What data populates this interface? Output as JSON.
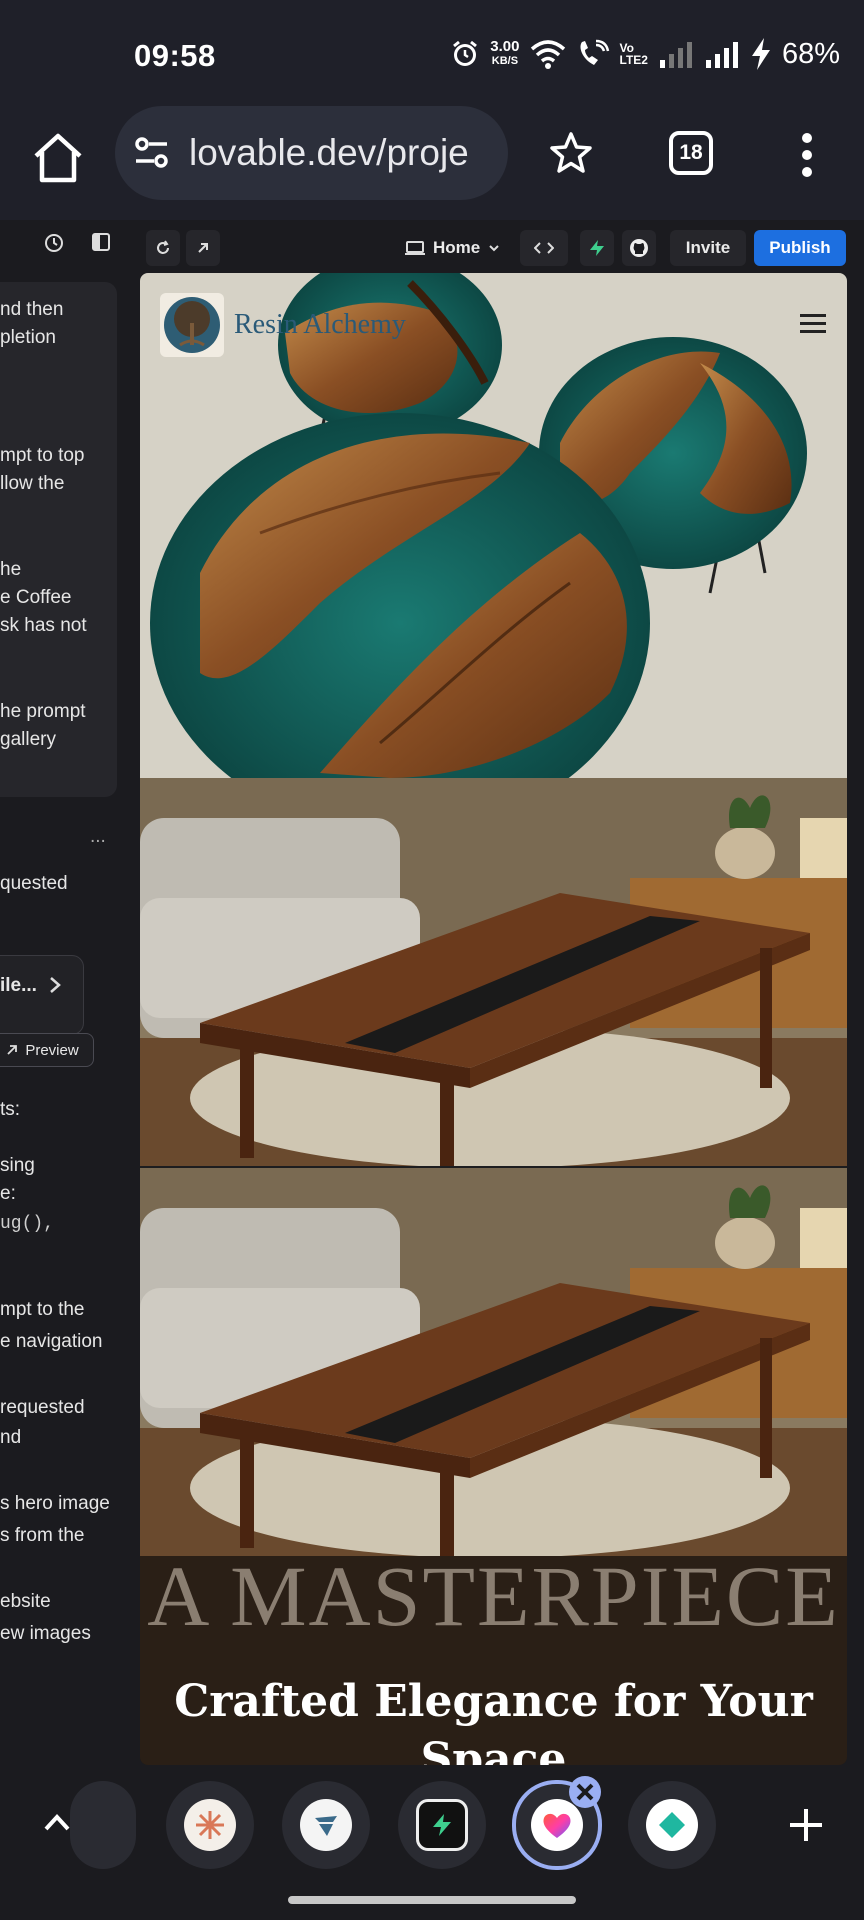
{
  "status_bar": {
    "time": "09:58",
    "speed_value": "3.00",
    "speed_unit": "KB/S",
    "network_label_1": "Vo",
    "network_label_2": "LTE2",
    "battery": "68%"
  },
  "browser": {
    "url": "lovable.dev/proje",
    "tab_count": "18"
  },
  "editor_toolbar": {
    "page_selector": "Home",
    "invite_label": "Invite",
    "publish_label": "Publish"
  },
  "chat_panel": {
    "lines": [
      "nd then",
      "pletion",
      "mpt to top",
      "llow the",
      "he",
      "e Coffee",
      "sk has not",
      "he prompt",
      "gallery",
      "quested",
      "ile...",
      "ts:",
      "sing",
      "e:",
      "ug(),",
      "mpt to the",
      "e navigation",
      "requested",
      "nd",
      "s hero image",
      "s from the",
      "ebsite",
      "ew images"
    ],
    "more_label": "...",
    "preview_label": "Preview"
  },
  "preview_site": {
    "brand_name": "Resin Alchemy",
    "masterpiece_text": "A MASTERPIECE",
    "headline_line1": "Crafted Elegance for Your",
    "headline_line2": "Space"
  },
  "colors": {
    "publish_blue": "#1d6fe0",
    "resin_teal": "#0e5a57",
    "walnut": "#6b3a1c",
    "supabase_green": "#3ecf8e"
  }
}
